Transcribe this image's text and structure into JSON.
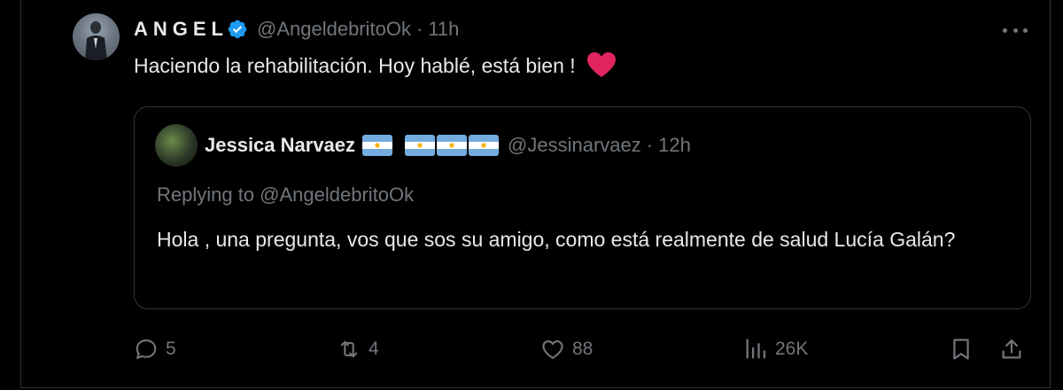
{
  "tweet": {
    "display_name": "ANGEL",
    "handle": "@AngeldebritoOk",
    "dot": "·",
    "time": "11h",
    "text": "Haciendo la rehabilitación. Hoy hablé, está bien !",
    "heart_icon": "red-heart-emoji"
  },
  "quote": {
    "name": "Jessica Narvaez",
    "flags": [
      "argentina-flag",
      "argentina-flag",
      "argentina-flag",
      "argentina-flag"
    ],
    "handle": "@Jessinarvaez",
    "dot": "·",
    "time": "12h",
    "replying": "Replying to @AngeldebritoOk",
    "text": "Hola , una pregunta, vos que sos su amigo, como está realmente de salud Lucía Galán?"
  },
  "actions": {
    "replies": "5",
    "reposts": "4",
    "likes": "88",
    "views": "26K"
  },
  "colors": {
    "background": "#000000",
    "text": "#e7e9ea",
    "muted": "#71767b",
    "border": "#2f3336",
    "verified": "#1d9bf0",
    "heart": "#e0245e"
  }
}
